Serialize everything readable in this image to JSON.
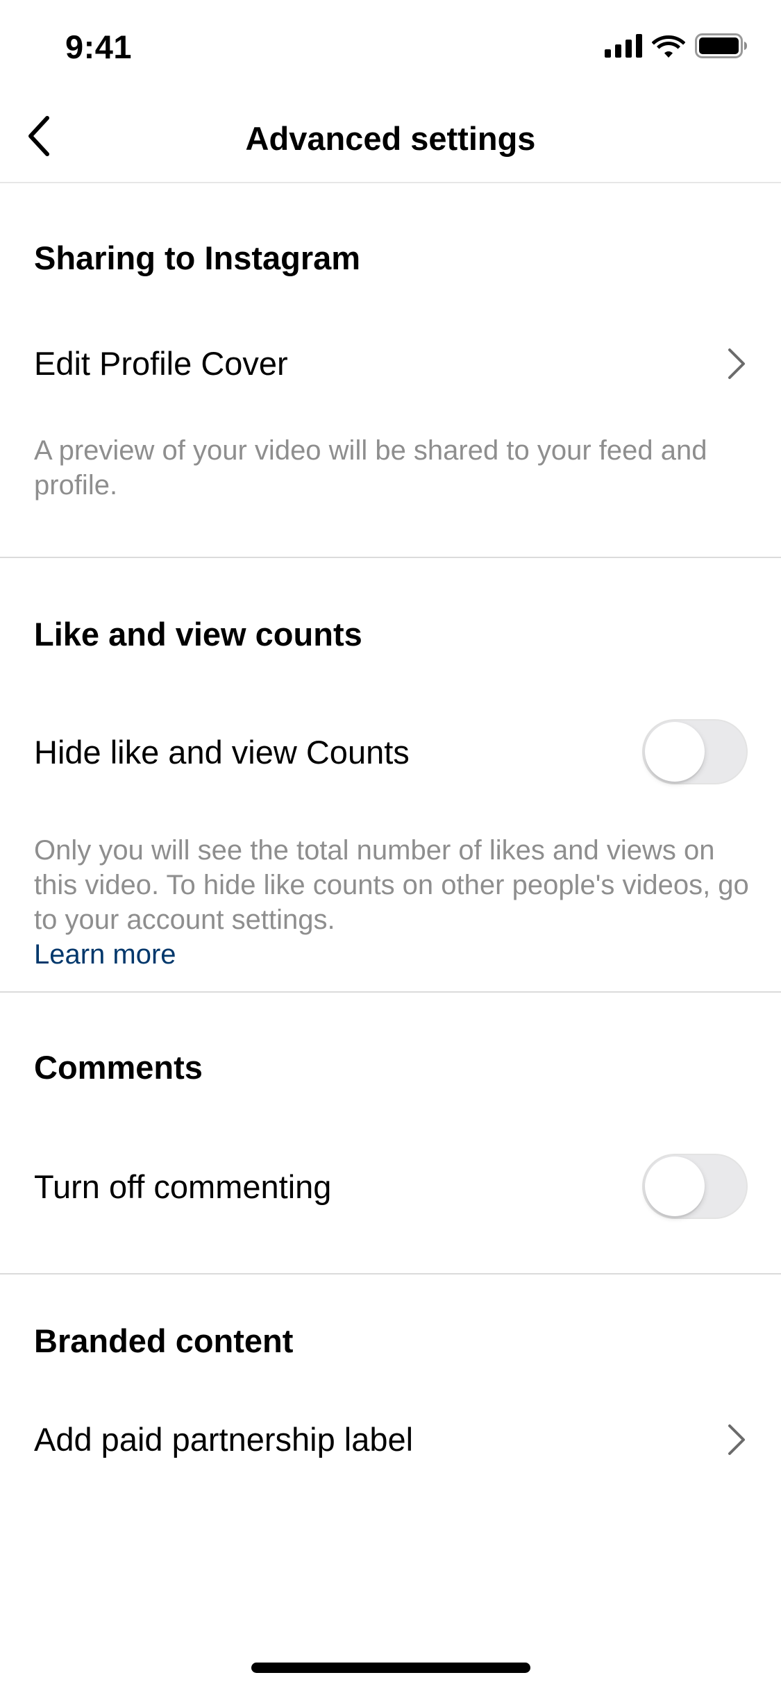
{
  "status_bar": {
    "time": "9:41"
  },
  "nav": {
    "title": "Advanced settings",
    "back_icon": "chevron-left-icon"
  },
  "sections": {
    "sharing": {
      "heading": "Sharing to Instagram",
      "row_label": "Edit Profile Cover",
      "description": "A preview of your video will be shared to your feed and profile."
    },
    "counts": {
      "heading": "Like and view counts",
      "row_label": "Hide like and view Counts",
      "toggle_on": false,
      "description": "Only you will see the total number of likes and views on this video. To hide like counts on other people's videos, go to your account settings.",
      "link": "Learn more"
    },
    "comments": {
      "heading": "Comments",
      "row_label": "Turn off commenting",
      "toggle_on": false
    },
    "branded": {
      "heading": "Branded content",
      "row_label": "Add paid partnership label"
    }
  },
  "colors": {
    "link": "#00376b",
    "secondary_text": "#8e8e8e",
    "divider": "#dbdbdb",
    "toggle_off": "#e9e9eb"
  }
}
